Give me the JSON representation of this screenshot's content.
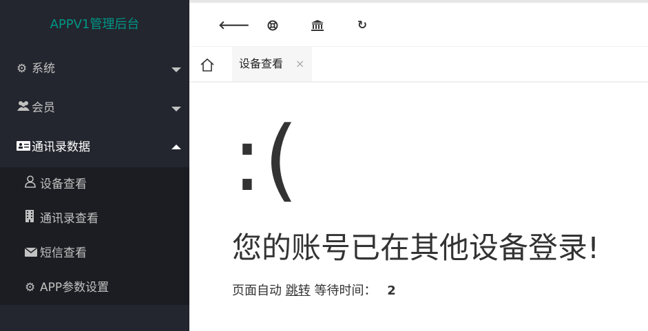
{
  "app_title": "APPV1管理后台",
  "sidebar": {
    "items": [
      {
        "label": "系统",
        "icon": "gear-icon"
      },
      {
        "label": "会员",
        "icon": "users-icon"
      },
      {
        "label": "通讯录数据",
        "icon": "id-card-icon"
      }
    ],
    "subitems": [
      {
        "label": "设备查看",
        "icon": "user-icon"
      },
      {
        "label": "通讯录查看",
        "icon": "building-icon"
      },
      {
        "label": "短信查看",
        "icon": "envelope-icon"
      },
      {
        "label": "APP参数设置",
        "icon": "gear-icon"
      }
    ]
  },
  "toolbar": {
    "buttons": [
      "back-icon",
      "lifebuoy-icon",
      "bank-icon",
      "refresh-icon"
    ]
  },
  "tabs": {
    "home_icon": "home-icon",
    "active_label": "设备查看",
    "close_glyph": "×"
  },
  "error": {
    "face": ":(",
    "message": "您的账号已在其他设备登录!",
    "redirect_prefix": "页面自动",
    "redirect_link": "跳转",
    "redirect_suffix": "等待时间：",
    "countdown": "2"
  },
  "colors": {
    "sidebar_bg": "#23262e",
    "subnav_bg": "#1b1d22",
    "brand": "#009688"
  }
}
